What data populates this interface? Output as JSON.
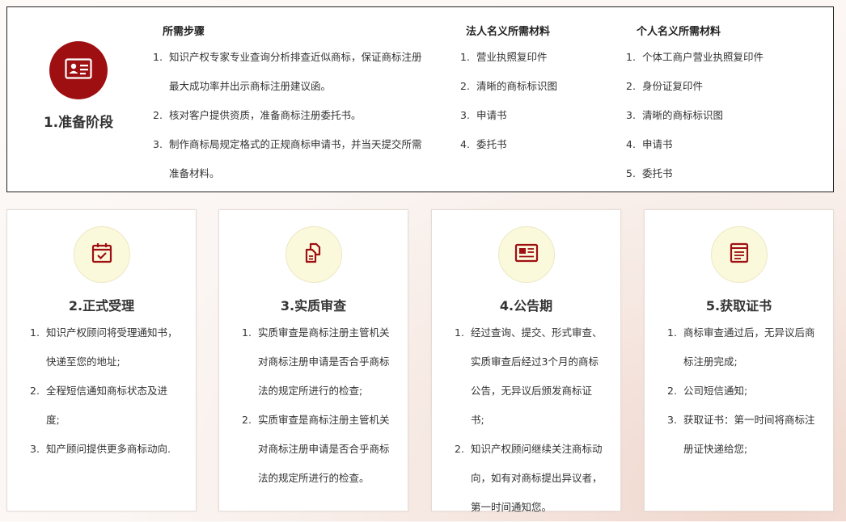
{
  "colors": {
    "accent": "#9e0f12",
    "icon_bg": "#fbf9dc"
  },
  "prep": {
    "icon": "id-card-icon",
    "stage": "1.准备阶段",
    "columns": [
      {
        "title": "所需步骤",
        "items": [
          {
            "num": "1.",
            "lines": [
              "知识产权专家专业查询分析排查近似商标，保证商标注册",
              "最大成功率并出示商标注册建议函。"
            ]
          },
          {
            "num": "2.",
            "lines": [
              "核对客户提供资质，准备商标注册委托书。"
            ]
          },
          {
            "num": "3.",
            "lines": [
              "制作商标局规定格式的正规商标申请书，并当天提交所需",
              "准备材料。"
            ]
          }
        ]
      },
      {
        "title": "法人名义所需材料",
        "items": [
          {
            "num": "1.",
            "lines": [
              "营业执照复印件"
            ]
          },
          {
            "num": "2.",
            "lines": [
              "清晰的商标标识图"
            ]
          },
          {
            "num": "3.",
            "lines": [
              "申请书"
            ]
          },
          {
            "num": "4.",
            "lines": [
              "委托书"
            ]
          }
        ]
      },
      {
        "title": "个人名义所需材料",
        "items": [
          {
            "num": "1.",
            "lines": [
              "个体工商户营业执照复印件"
            ]
          },
          {
            "num": "2.",
            "lines": [
              "身份证复印件"
            ]
          },
          {
            "num": "3.",
            "lines": [
              "清晰的商标标识图"
            ]
          },
          {
            "num": "4.",
            "lines": [
              "申请书"
            ]
          },
          {
            "num": "5.",
            "lines": [
              "委托书"
            ]
          }
        ]
      }
    ]
  },
  "cards": [
    {
      "icon": "calendar-check-icon",
      "title": "2.正式受理",
      "items": [
        {
          "num": "1.",
          "lines": [
            "知识产权顾问将受理通知书，",
            "快递至您的地址;"
          ]
        },
        {
          "num": "2.",
          "lines": [
            "全程短信通知商标状态及进度;"
          ]
        },
        {
          "num": "3.",
          "lines": [
            "知产顾问提供更多商标动向."
          ]
        }
      ]
    },
    {
      "icon": "copy-documents-icon",
      "title": "3.实质审查",
      "items": [
        {
          "num": "1.",
          "lines": [
            "实质审查是商标注册主管机关",
            "对商标注册申请是否合乎商标",
            "法的规定所进行的检查;"
          ]
        },
        {
          "num": "2.",
          "lines": [
            "实质审查是商标注册主管机关",
            "对商标注册申请是否合乎商标",
            "法的规定所进行的检查。"
          ]
        }
      ]
    },
    {
      "icon": "newspaper-icon",
      "title": "4.公告期",
      "items": [
        {
          "num": "1.",
          "lines": [
            "经过查询、提交、形式审查、",
            "实质审查后经过3个月的商标",
            "公告，无异议后颁发商标证书;"
          ]
        },
        {
          "num": "2.",
          "lines": [
            "知识产权顾问继续关注商标动",
            "向，如有对商标提出异议者，",
            "第一时间通知您。"
          ]
        }
      ]
    },
    {
      "icon": "certificate-icon",
      "title": "5.获取证书",
      "items": [
        {
          "num": "1.",
          "lines": [
            "商标审查通过后，无异议后商",
            "标注册完成;"
          ]
        },
        {
          "num": "2.",
          "lines": [
            "公司短信通知;"
          ]
        },
        {
          "num": "3.",
          "lines": [
            "获取证书：第一时间将商标注",
            "册证快递给您;"
          ]
        }
      ]
    }
  ]
}
